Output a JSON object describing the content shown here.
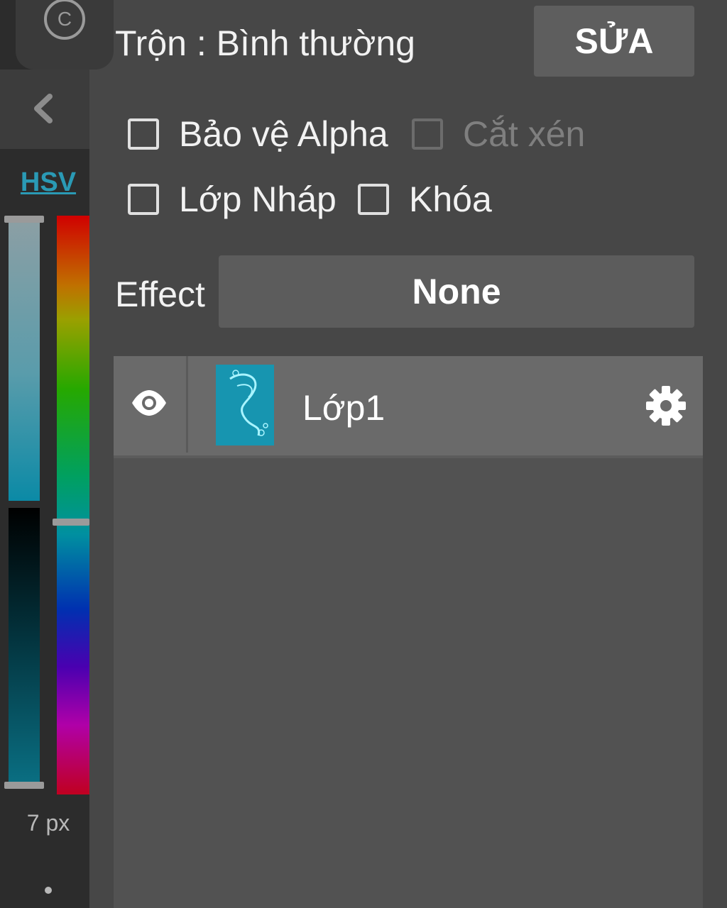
{
  "sidebar": {
    "color_mode_label": "HSV",
    "brush_size": "7 px",
    "hue_position": 0.53,
    "saturation_position": 0.0,
    "value_position": 1.0,
    "accent_color": "#2a9ab5"
  },
  "layer_props": {
    "blend_mode_label": "Trộn : Bình thường",
    "edit_button": "SỬA",
    "protect_alpha": "Bảo vệ Alpha",
    "clipping": "Cắt xén",
    "draft_layer": "Lớp Nháp",
    "lock": "Khóa",
    "effect_label": "Effect",
    "effect_value": "None"
  },
  "layers": [
    {
      "name": "Lớp1",
      "visible": true,
      "thumbnail_color": "#1795b0"
    }
  ]
}
